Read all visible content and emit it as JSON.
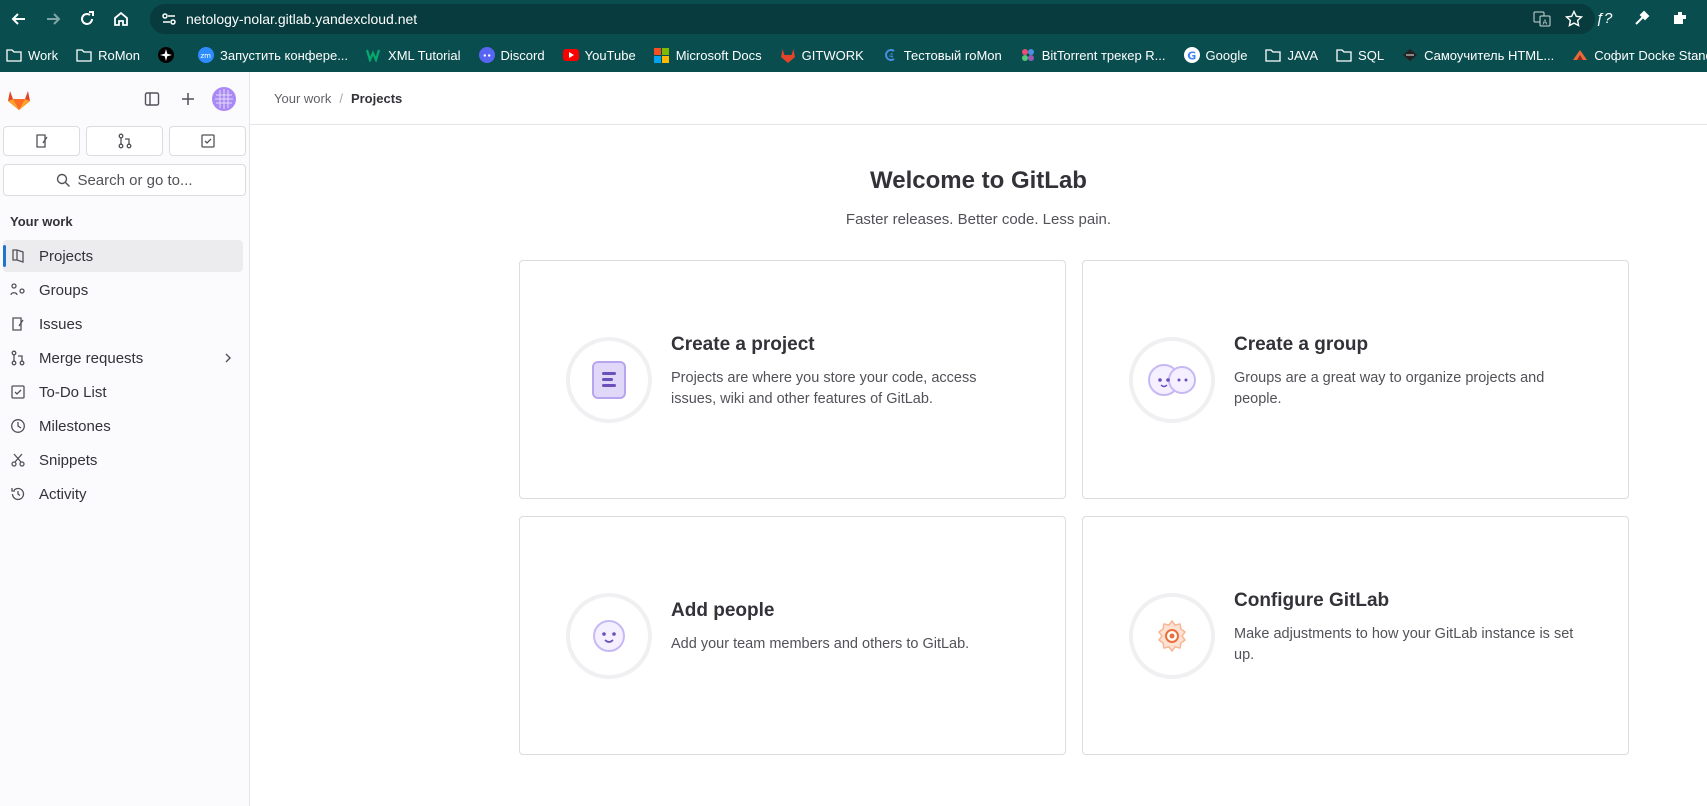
{
  "browser": {
    "url": "netology-nolar.gitlab.yandexcloud.net",
    "bookmarks": [
      {
        "label": "Work",
        "icon": "folder-icon"
      },
      {
        "label": "RoMon",
        "icon": "folder-icon"
      },
      {
        "label": "",
        "icon": "star-app-icon"
      },
      {
        "label": "Запустить конфере...",
        "icon": "zoom-icon"
      },
      {
        "label": "XML Tutorial",
        "icon": "w3-icon"
      },
      {
        "label": "Discord",
        "icon": "discord-icon"
      },
      {
        "label": "YouTube",
        "icon": "youtube-icon"
      },
      {
        "label": "Microsoft Docs",
        "icon": "microsoft-icon"
      },
      {
        "label": "GITWORK",
        "icon": "gitlab-icon"
      },
      {
        "label": "Тестовый roMon",
        "icon": "romon-icon"
      },
      {
        "label": "BitTorrent трекер R...",
        "icon": "torrent-icon"
      },
      {
        "label": "Google",
        "icon": "google-icon"
      },
      {
        "label": "JAVA",
        "icon": "folder-icon"
      },
      {
        "label": "SQL",
        "icon": "folder-icon"
      },
      {
        "label": "Самоучитель HTML...",
        "icon": "html-icon"
      },
      {
        "label": "Софит Docke Stand...",
        "icon": "sofit-icon"
      }
    ]
  },
  "sidebar": {
    "search_label": "Search or go to...",
    "section_title": "Your work",
    "items": [
      {
        "label": "Projects",
        "icon": "project-icon"
      },
      {
        "label": "Groups",
        "icon": "group-icon"
      },
      {
        "label": "Issues",
        "icon": "issues-icon"
      },
      {
        "label": "Merge requests",
        "icon": "merge-request-icon"
      },
      {
        "label": "To-Do List",
        "icon": "todo-icon"
      },
      {
        "label": "Milestones",
        "icon": "milestone-icon"
      },
      {
        "label": "Snippets",
        "icon": "snippet-icon"
      },
      {
        "label": "Activity",
        "icon": "history-icon"
      }
    ]
  },
  "breadcrumb": {
    "parent": "Your work",
    "separator": "/",
    "current": "Projects"
  },
  "main": {
    "title": "Welcome to GitLab",
    "subtitle": "Faster releases. Better code. Less pain.",
    "cards": [
      {
        "title": "Create a project",
        "description": "Projects are where you store your code, access issues, wiki and other features of GitLab."
      },
      {
        "title": "Create a group",
        "description": "Groups are a great way to organize projects and people."
      },
      {
        "title": "Add people",
        "description": "Add your team members and others to GitLab."
      },
      {
        "title": "Configure GitLab",
        "description": "Make adjustments to how your GitLab instance is set up."
      }
    ]
  },
  "colors": {
    "chrome": "#0a4d4f",
    "active_indicator": "#1f75cb",
    "accent_purple": "#6b4fbb",
    "accent_orange": "#e9703a"
  }
}
